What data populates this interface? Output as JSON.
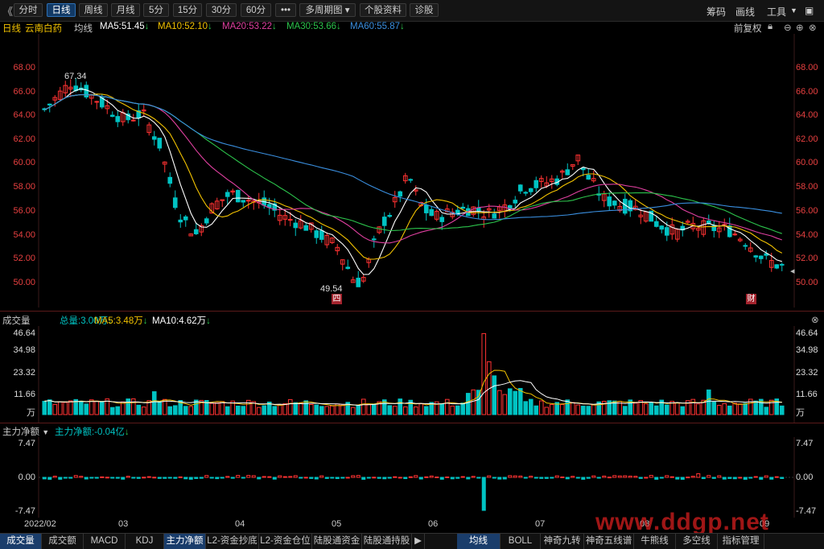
{
  "toolbar": {
    "collapse": "《",
    "periods": [
      "分时",
      "日线",
      "周线",
      "月线",
      "5分",
      "15分",
      "30分",
      "60分"
    ],
    "more": "•••",
    "multi_period": "多周期图",
    "stock_info": "个股资料",
    "diagnose": "诊股",
    "chips": "筹码",
    "draw": "画线",
    "tools": "工具"
  },
  "ma_bar": {
    "period": "日线",
    "stock_name": "云南白药",
    "avg_label": "均线",
    "ma5": "MA5:51.45",
    "ma10": "MA10:52.10",
    "ma20": "MA20:53.22",
    "ma30": "MA30:53.66",
    "ma60": "MA60:55.87",
    "adjust": "前复权"
  },
  "price_axis": [
    "68.00",
    "66.00",
    "64.00",
    "62.00",
    "60.00",
    "58.00",
    "56.00",
    "54.00",
    "52.00",
    "50.00"
  ],
  "price_annotations": {
    "high": "67.34",
    "low": "49.54",
    "flag1": "四",
    "flag2": "财"
  },
  "volume_bar": {
    "title": "成交量",
    "total": "总量:3.00万",
    "ma5": "MA5:3.48万",
    "ma10": "MA10:4.62万"
  },
  "volume_axis": [
    "46.64",
    "34.98",
    "23.32",
    "11.66",
    "万"
  ],
  "flow_bar": {
    "title": "主力净额",
    "value": "主力净额:-0.04亿"
  },
  "flow_axis": [
    "7.47",
    "0.00",
    "-7.47"
  ],
  "date_axis": [
    "2022/02",
    "03",
    "04",
    "05",
    "06",
    "07",
    "08",
    "09"
  ],
  "bottom_tabs": [
    "成交量",
    "成交额",
    "MACD",
    "KDJ",
    "主力净额",
    "L2-资金抄底",
    "L2-资金仓位",
    "陆股通资金",
    "陆股通持股"
  ],
  "bottom_tabs_right": [
    "均线",
    "BOLL",
    "神奇九转",
    "神奇五线谱",
    "牛熊线",
    "多空线",
    "指标管理"
  ],
  "watermark": "www.ddgp.net",
  "colors": {
    "up": "#ff3232",
    "down": "#00c3c3",
    "ma5": "#ffffff",
    "ma10": "#f2c200",
    "ma20": "#e040a0",
    "ma30": "#2cc44c",
    "ma60": "#3a8fe0"
  }
}
